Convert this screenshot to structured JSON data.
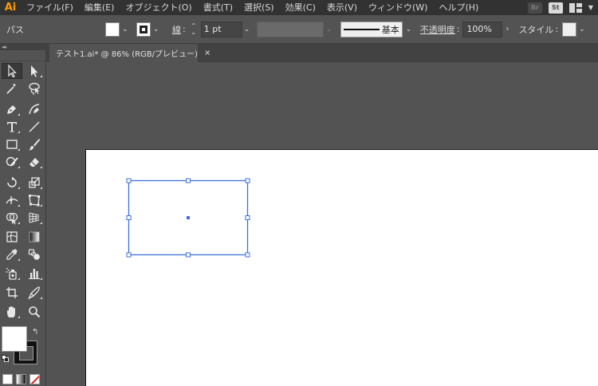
{
  "app": {
    "logo": "Ai"
  },
  "menu": {
    "items": [
      "ファイル(F)",
      "編集(E)",
      "オブジェクト(O)",
      "書式(T)",
      "選択(S)",
      "効果(C)",
      "表示(V)",
      "ウィンドウ(W)",
      "ヘルプ(H)"
    ],
    "bridge_badge": "Br",
    "stock_badge": "St"
  },
  "control": {
    "selection_type": "パス",
    "stroke_label": "線",
    "stroke_weight": "1 pt",
    "brush_name": "基本",
    "opacity_label": "不透明度",
    "opacity_value": "100%",
    "style_label": "スタイル"
  },
  "document": {
    "tab_title": "テスト1.ai* @ 86% (RGB/プレビュー)",
    "close_glyph": "×"
  },
  "tools": {
    "panel_header": "◂◂",
    "swap_glyph": "↰"
  },
  "colors": {
    "accent_selection": "#3d6fe0",
    "logo": "#ff9a00",
    "none_slash": "#e02020"
  }
}
